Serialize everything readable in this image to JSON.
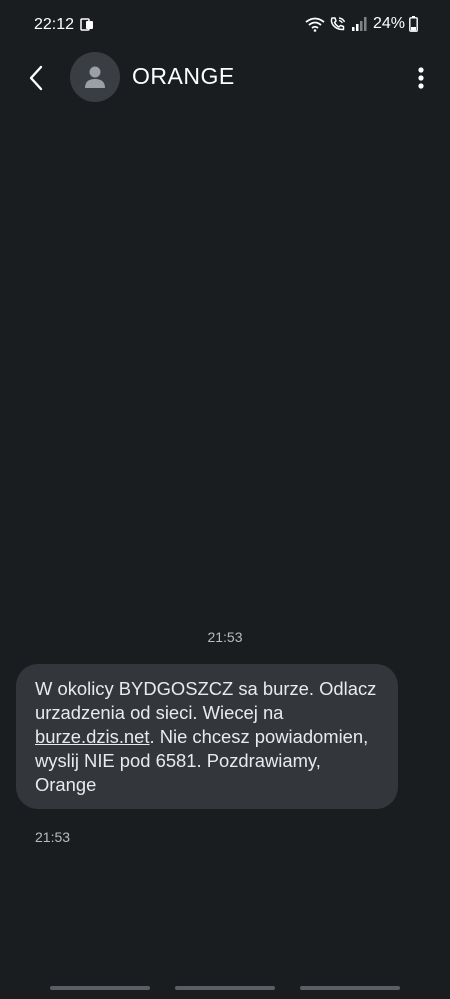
{
  "status_bar": {
    "time": "22:12",
    "battery": "24%",
    "icons": [
      "notification-icon",
      "wifi-calling-icon",
      "phone-wifi-icon",
      "signal-icon",
      "battery-icon"
    ]
  },
  "header": {
    "contact_name": "ORANGE",
    "icons": [
      "back-arrow-icon",
      "person-icon",
      "more-vert-icon"
    ]
  },
  "conversation": {
    "date_timestamp": "21:53",
    "message": {
      "text_before_link": "W okolicy BYDGOSZCZ sa burze. Odlacz urzadzenia od sieci. Wiecej na ",
      "link": "burze.dzis.net",
      "text_after_link": ". Nie chcesz powiadomien, wyslij NIE pod 6581. Pozdrawiamy, Orange",
      "time": "21:53"
    }
  },
  "colors": {
    "background": "#1a1d20",
    "bubble": "#33373b",
    "text": "#e8eaed",
    "muted": "#b8bbbf",
    "avatar": "#3a3d41"
  }
}
